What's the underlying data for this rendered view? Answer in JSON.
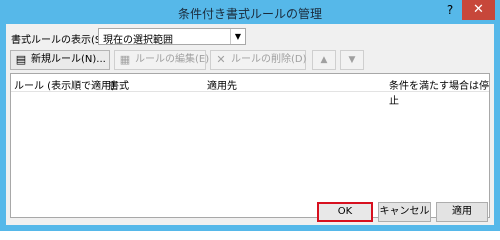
{
  "window": {
    "title": "条件付き書式ルールの管理",
    "help_label": "?",
    "close_label": "✕"
  },
  "scope": {
    "label": "書式ルールの表示(S):",
    "selected": "現在の選択範囲"
  },
  "toolbar": {
    "new_rule": "新規ルール(N)...",
    "edit_rule": "ルールの編集(E)...",
    "delete_rule": "ルールの削除(D)",
    "move_up": "▲",
    "move_down": "▼"
  },
  "list": {
    "columns": [
      "ルール (表示順で適用)",
      "書式",
      "適用先",
      "条件を満たす場合は停止"
    ]
  },
  "buttons": {
    "ok": "OK",
    "cancel": "キャンセル",
    "apply": "適用"
  },
  "colors": {
    "frame": "#56b8e9",
    "close": "#c7473a",
    "highlight": "#d7101f"
  }
}
